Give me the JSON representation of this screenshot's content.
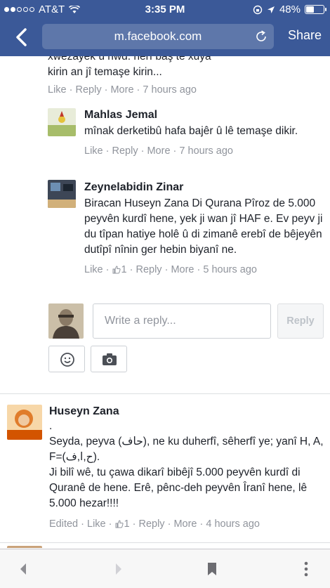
{
  "status_bar": {
    "carrier": "AT&T",
    "time": "3:35 PM",
    "battery": "48%",
    "battery_level": 0.48
  },
  "browser": {
    "url": "m.facebook.com",
    "share_label": "Share"
  },
  "comments": [
    {
      "text": "xwezayek û hwd. herî baş te xuya kirin an jî temaşe kirin...",
      "actions": {
        "like": "Like",
        "reply": "Reply",
        "more": "More",
        "time": "7 hours ago"
      }
    },
    {
      "name": "Mahlas Jemal",
      "text": "mînak derketibû hafa bajêr û lê temaşe dikir.",
      "actions": {
        "like": "Like",
        "reply": "Reply",
        "more": "More",
        "time": "7 hours ago"
      }
    },
    {
      "name": "Zeynelabidin Zinar",
      "text": "Biracan Huseyn Zana Di Qurana Pîroz de 5.000 peyvên kurdî hene, yek ji wan jî HAF e. Ev peyv ji du tîpan hatiye holê û di zimanê erebî de bêjeyên dutîpî nînin ger hebin biyanî ne.",
      "actions": {
        "like": "Like",
        "like_count": "1",
        "reply": "Reply",
        "more": "More",
        "time": "5 hours ago"
      }
    }
  ],
  "composer": {
    "placeholder": "Write a reply...",
    "reply_button": "Reply"
  },
  "main_comment": {
    "name": "Huseyn Zana",
    "dot": ".",
    "paragraph1": "Seyda, peyva (حاف), ne ku duherfî, sêherfî ye; yanî H, A, F=(ح,ا,ف).",
    "paragraph2": "Ji bilî wê, tu çawa dikarî bibêjî 5.000 peyvên kurdî di Quranê de hene. Erê, pênc-deh peyvên Îranî hene, lê 5.000 hezar!!!!",
    "actions": {
      "edited": "Edited",
      "like": "Like",
      "like_count": "1",
      "reply": "Reply",
      "more": "More",
      "time": "4 hours ago"
    }
  },
  "colors": {
    "facebook_blue": "#3b5998",
    "meta_gray": "#90949c",
    "text": "#1d2129"
  },
  "toolbar_icons": [
    "back-icon",
    "forward-icon",
    "bookmark-icon",
    "more-icon"
  ]
}
